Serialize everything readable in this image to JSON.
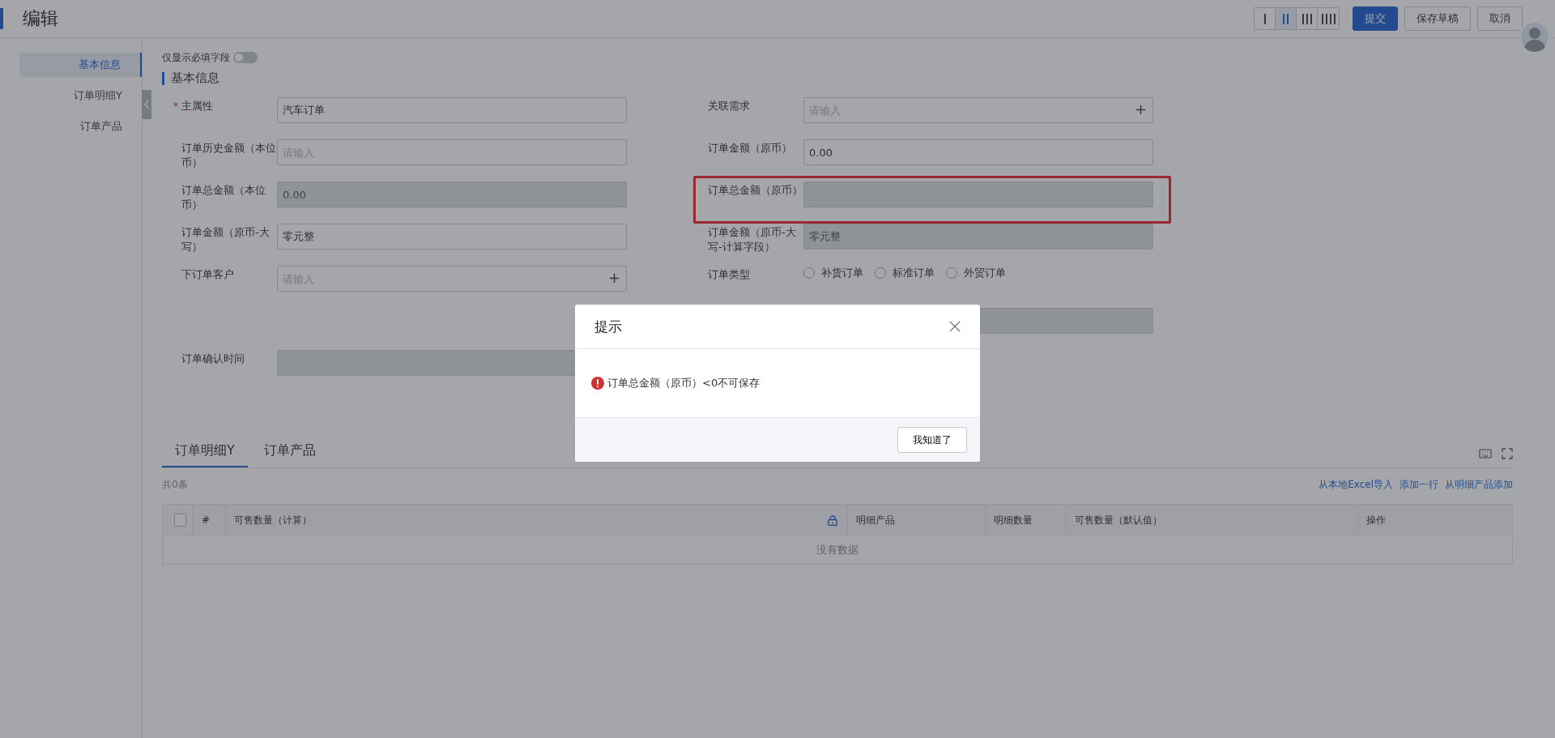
{
  "header": {
    "title": "编辑",
    "layout_options": [
      {
        "selected": false
      },
      {
        "selected": true
      },
      {
        "selected": false
      },
      {
        "selected": false
      }
    ],
    "buttons": [
      {
        "label": "提交",
        "kind": "primary"
      },
      {
        "label": "保存草稿",
        "kind": "default"
      },
      {
        "label": "取消",
        "kind": "default"
      }
    ]
  },
  "sidebar": {
    "items": [
      {
        "label": "基本信息",
        "selected": true
      },
      {
        "label": "订单明细Y",
        "selected": false
      },
      {
        "label": "订单产品",
        "selected": false
      }
    ]
  },
  "required_toggle": {
    "label": "仅显示必填字段",
    "on": false
  },
  "section_title": "基本信息",
  "form_rows": [
    {
      "left": {
        "kind": "text",
        "label": "主属性",
        "required_mark": "*",
        "value": "汽车订单",
        "disabled": false
      },
      "right": {
        "kind": "text",
        "label": "关联需求",
        "placeholder": "请输入",
        "suffix": "+",
        "disabled": false
      }
    },
    {
      "left": {
        "kind": "text",
        "label": "订单历史金额（本位币）",
        "placeholder": "请输入",
        "disabled": false
      },
      "right": {
        "kind": "text",
        "label": "订单金额（原币）",
        "value": "0.00",
        "disabled": false
      }
    },
    {
      "left": {
        "kind": "text",
        "label": "订单总金额（本位币）",
        "value": "0.00",
        "disabled": true
      },
      "right": {
        "kind": "text",
        "label": "订单总金额（原币）",
        "disabled": true,
        "highlighted": true
      }
    },
    {
      "left": {
        "kind": "text",
        "label": "订单金额（原币-大写）",
        "value": "零元整",
        "disabled": false
      },
      "right": {
        "kind": "text",
        "label": "订单金额（原币-大写-计算字段）",
        "value": "零元整",
        "disabled": true
      }
    },
    {
      "left": {
        "kind": "text",
        "label": "下订单客户",
        "placeholder": "请输入",
        "suffix": "+",
        "disabled": false
      },
      "right": {
        "kind": "radio",
        "label": "订单类型",
        "options": [
          {
            "label": "补货订单",
            "selected": false
          },
          {
            "label": "标准订单",
            "selected": false
          },
          {
            "label": "外贸订单",
            "selected": false
          }
        ]
      }
    },
    {
      "right": {
        "kind": "text",
        "disabled": true
      }
    },
    {
      "left": {
        "kind": "text",
        "label": "订单确认时间",
        "disabled": true
      }
    }
  ],
  "tabs": [
    {
      "label": "订单明细Y",
      "selected": true
    },
    {
      "label": "订单产品",
      "selected": false
    }
  ],
  "record_count": "共0条",
  "table_actions": [
    "从本地Excel导入",
    "添加一行",
    "从明细产品添加"
  ],
  "table": {
    "select_all_checked": false,
    "columns": [
      {
        "label": "#",
        "locked": false
      },
      {
        "label": "可售数量（计算）",
        "locked": true
      },
      {
        "label": "明细产品",
        "locked": false
      },
      {
        "label": "明细数量",
        "locked": false
      },
      {
        "label": "可售数量（默认值）",
        "locked": false
      },
      {
        "label": "操作",
        "locked": false
      }
    ],
    "empty_text": "没有数据"
  },
  "dialog": {
    "title": "提示",
    "message": "订单总金额（原币）<0不可保存",
    "button": "我知道了"
  }
}
